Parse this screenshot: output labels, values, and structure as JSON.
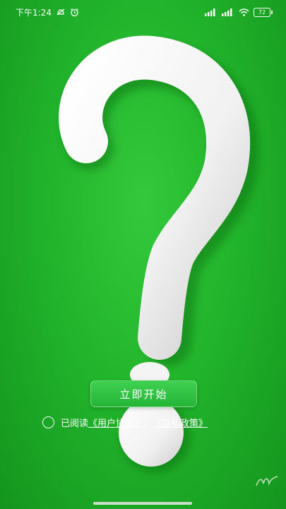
{
  "status_bar": {
    "time": "下午1:24",
    "battery": "72",
    "icons": [
      "dnd-off-icon",
      "alarm-icon",
      "signal-icon",
      "signal-icon",
      "wifi-icon",
      "battery-icon"
    ]
  },
  "artwork": {
    "subject": "question-mark",
    "background_color": "#22b52c"
  },
  "start_button": {
    "label": "立即开始"
  },
  "agreement": {
    "prefix": "已阅读",
    "user_agreement": "《用户协议》",
    "separator": "、",
    "privacy_policy": "《隐私政策》"
  },
  "colors": {
    "accent": "#2fc041",
    "text": "#ffffff"
  }
}
